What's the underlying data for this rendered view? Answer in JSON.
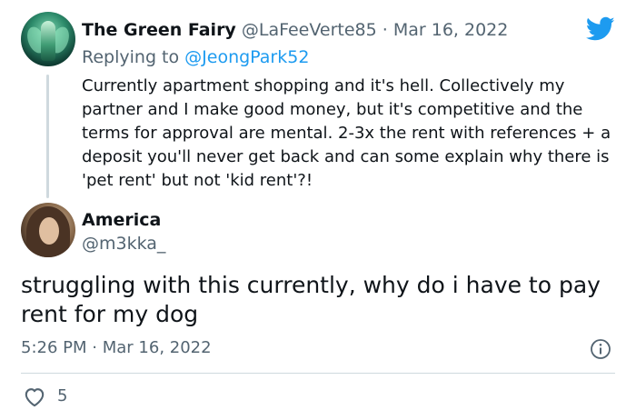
{
  "parent_tweet": {
    "display_name": "The Green Fairy",
    "handle": "@LaFeeVerte85",
    "separator": "·",
    "date": "Mar 16, 2022",
    "replying_prefix": "Replying to ",
    "replying_to": "@JeongPark52",
    "text": "Currently apartment shopping and it's hell. Collectively my partner and I make good money, but it's competitive and the terms for approval are mental. 2-3x the rent with references + a deposit you'll never get back and can some explain why there is 'pet rent' but not 'kid rent'?!"
  },
  "main_tweet": {
    "display_name": "America",
    "handle": "@m3kka_",
    "text": "struggling with this currently, why do i have to pay rent for my dog",
    "time": "5:26 PM",
    "separator": "·",
    "date": "Mar 16, 2022",
    "like_count": "5"
  },
  "icons": {
    "brand": "twitter-bird-icon",
    "info": "info-icon",
    "like": "heart-icon"
  },
  "colors": {
    "brand_blue": "#1d9bf0",
    "text_primary": "#0f1419",
    "text_secondary": "#536471",
    "divider": "#cfd9de"
  }
}
